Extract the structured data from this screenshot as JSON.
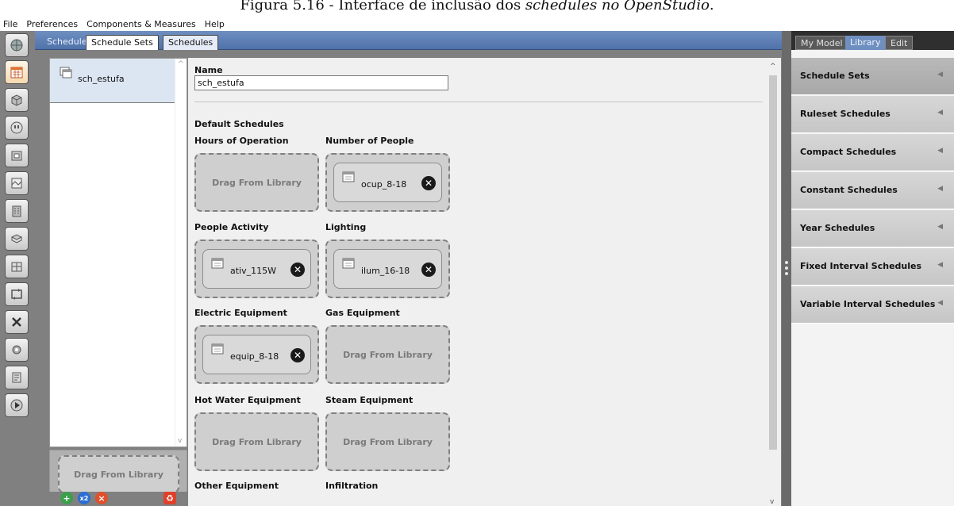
{
  "caption": {
    "prefix": "Figura 5.16 - Interface de inclusão dos ",
    "italic": "schedules no OpenStudio",
    "suffix": "."
  },
  "menu": [
    "File",
    "Preferences",
    "Components & Measures",
    "Help"
  ],
  "tabs": {
    "root": "Schedules",
    "active": "Schedule Sets",
    "other": "Schedules"
  },
  "list": {
    "selected_item": "sch_estufa",
    "drop_label": "Drag From Library"
  },
  "editor": {
    "name_label": "Name",
    "name_value": "sch_estufa",
    "default_label": "Default Schedules",
    "drag_label": "Drag From Library",
    "slots": [
      {
        "label": "Hours of Operation",
        "value": ""
      },
      {
        "label": "Number of People",
        "value": "ocup_8-18"
      },
      {
        "label": "People Activity",
        "value": "ativ_115W"
      },
      {
        "label": "Lighting",
        "value": "ilum_16-18"
      },
      {
        "label": "Electric Equipment",
        "value": "equip_8-18"
      },
      {
        "label": "Gas Equipment",
        "value": ""
      },
      {
        "label": "Hot Water Equipment",
        "value": ""
      },
      {
        "label": "Steam Equipment",
        "value": ""
      },
      {
        "label": "Other Equipment",
        "value": ""
      },
      {
        "label": "Infiltration",
        "value": ""
      }
    ]
  },
  "right": {
    "tabs": [
      "My Model",
      "Library",
      "Edit"
    ],
    "items": [
      "Schedule Sets",
      "Ruleset Schedules",
      "Compact Schedules",
      "Constant Schedules",
      "Year Schedules",
      "Fixed Interval Schedules",
      "Variable Interval Schedules"
    ]
  },
  "actions": {
    "copy_label": "x2"
  },
  "colors": {
    "tabbar": "#5b7db4",
    "panel_gray": "#808080",
    "library_tab": "#6f8fc0",
    "selected_row": "#dce6f3"
  }
}
